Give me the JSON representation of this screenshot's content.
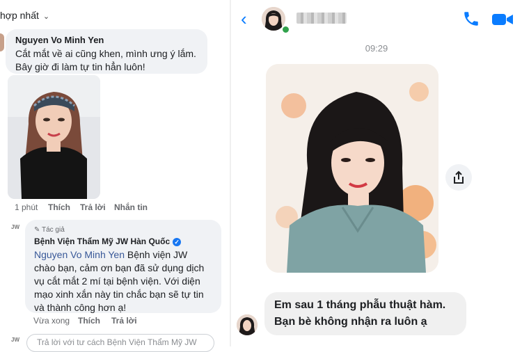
{
  "left_panel": {
    "sort_label": "hợp nhất",
    "comment": {
      "author": "Nguyen Vo Minh Yen",
      "line1": "Cắt mắt về ai cũng khen, mình ưng ý lắm.",
      "line2": "Bây giờ đi làm tự tin hẳn luôn!",
      "time": "1 phút",
      "like": "Thích",
      "reply": "Trả lời",
      "message": "Nhắn tin"
    },
    "reply": {
      "logo_text": "JW",
      "badge": "Tác giả",
      "page_name": "Bệnh Viện Thẩm Mỹ JW Hàn Quốc",
      "mention": "Nguyen Vo Minh Yen",
      "line1_rest": " Bệnh viện JW",
      "line2": "chào bạn, cảm ơn bạn đã sử dụng dịch",
      "line3": "vụ cắt mắt 2 mí tại bệnh viện. Với diện",
      "line4": "mạo xinh xắn này tin chắc bạn sẽ tự tin",
      "line5": "và thành công hơn ạ!",
      "time": "Vừa xong",
      "like": "Thích",
      "reply": "Trả lời"
    },
    "reply_input_placeholder": "Trả lời với tư cách Bệnh Viện Thẩm Mỹ JW"
  },
  "right_panel": {
    "timestamp": "09:29",
    "message_line1": "Em sau 1 tháng phẫu thuật hàm.",
    "message_line2": "Bạn bè không nhận ra luôn ạ",
    "accent_color": "#0a7cff"
  }
}
